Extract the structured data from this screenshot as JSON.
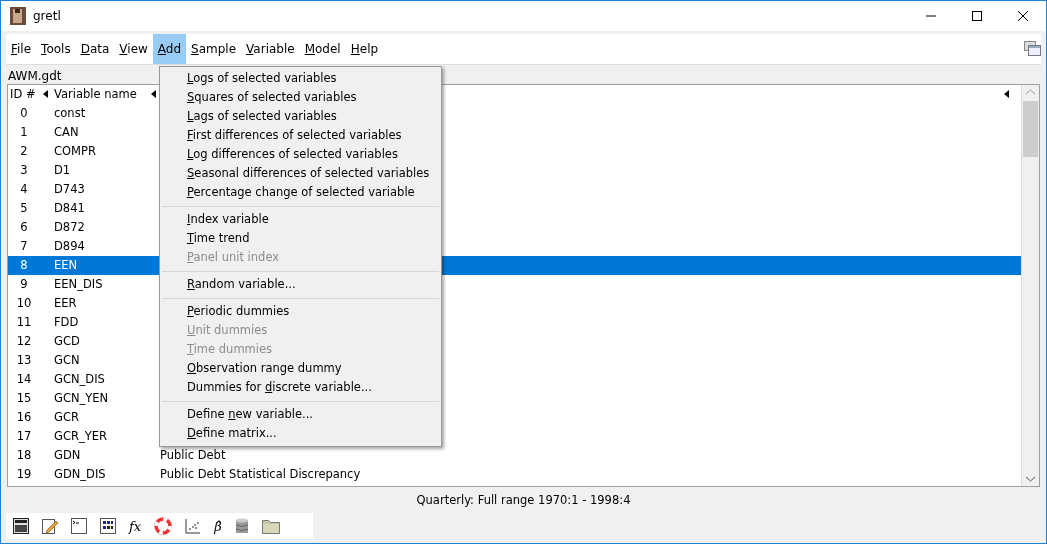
{
  "window": {
    "title": "gretl"
  },
  "menubar": [
    {
      "key": "F",
      "post": "ile",
      "selected": false
    },
    {
      "key": "T",
      "post": "ools",
      "selected": false
    },
    {
      "key": "D",
      "post": "ata",
      "selected": false
    },
    {
      "key": "V",
      "post": "iew",
      "selected": false
    },
    {
      "key": "A",
      "post": "dd",
      "selected": true
    },
    {
      "key": "S",
      "post": "ample",
      "selected": false
    },
    {
      "key": "V",
      "post": "ariable",
      "selected": false
    },
    {
      "key": "M",
      "post": "odel",
      "selected": false
    },
    {
      "key": "H",
      "post": "elp",
      "selected": false
    }
  ],
  "file_label": "AWM.gdt",
  "table": {
    "columns": [
      "ID #",
      "Variable name"
    ],
    "rows": [
      {
        "id": "0",
        "name": "const",
        "selected": false
      },
      {
        "id": "1",
        "name": "CAN",
        "selected": false
      },
      {
        "id": "2",
        "name": "COMPR",
        "selected": false
      },
      {
        "id": "3",
        "name": "D1",
        "selected": false
      },
      {
        "id": "4",
        "name": "D743",
        "selected": false
      },
      {
        "id": "5",
        "name": "D841",
        "selected": false
      },
      {
        "id": "6",
        "name": "D872",
        "selected": false
      },
      {
        "id": "7",
        "name": "D894",
        "selected": false
      },
      {
        "id": "8",
        "name": "EEN",
        "selected": true
      },
      {
        "id": "9",
        "name": "EEN_DIS",
        "selected": false
      },
      {
        "id": "10",
        "name": "EER",
        "selected": false
      },
      {
        "id": "11",
        "name": "FDD",
        "selected": false
      },
      {
        "id": "12",
        "name": "GCD",
        "selected": false
      },
      {
        "id": "13",
        "name": "GCN",
        "selected": false
      },
      {
        "id": "14",
        "name": "GCN_DIS",
        "selected": false
      },
      {
        "id": "15",
        "name": "GCN_YEN",
        "selected": false
      },
      {
        "id": "16",
        "name": "GCR",
        "selected": false
      },
      {
        "id": "17",
        "name": "GCR_YER",
        "selected": false
      },
      {
        "id": "18",
        "name": "GDN",
        "description": "Public Debt",
        "selected": false
      },
      {
        "id": "19",
        "name": "GDN_DIS",
        "description": "Public Debt Statistical Discrepancy",
        "selected": false
      }
    ]
  },
  "add_menu": [
    {
      "kind": "item",
      "key": "L",
      "post": "ogs of selected variables",
      "disabled": false
    },
    {
      "kind": "item",
      "key": "S",
      "post": "quares of selected variables",
      "disabled": false
    },
    {
      "kind": "item",
      "key": "L",
      "post": "ags of selected variables",
      "disabled": false
    },
    {
      "kind": "item",
      "key": "F",
      "post": "irst differences of selected variables",
      "disabled": false
    },
    {
      "kind": "item",
      "key": "L",
      "post": "og differences of selected variables",
      "disabled": false
    },
    {
      "kind": "item",
      "key": "S",
      "post": "easonal differences of selected variables",
      "disabled": false
    },
    {
      "kind": "item",
      "key": "P",
      "post": "ercentage change of selected variable",
      "disabled": false
    },
    {
      "kind": "separator"
    },
    {
      "kind": "item",
      "key": "I",
      "post": "ndex variable",
      "disabled": false
    },
    {
      "kind": "item",
      "key": "T",
      "post": "ime trend",
      "disabled": false
    },
    {
      "kind": "item",
      "key": "P",
      "post": "anel unit index",
      "disabled": true
    },
    {
      "kind": "separator"
    },
    {
      "kind": "item",
      "key": "R",
      "post": "andom variable...",
      "disabled": false
    },
    {
      "kind": "separator"
    },
    {
      "kind": "item",
      "key": "P",
      "post": "eriodic dummies",
      "disabled": false
    },
    {
      "kind": "item",
      "key": "U",
      "post": "nit dummies",
      "disabled": true
    },
    {
      "kind": "item",
      "key": "T",
      "post": "ime dummies",
      "disabled": true
    },
    {
      "kind": "item",
      "key": "O",
      "post": "bservation range dummy",
      "disabled": false
    },
    {
      "kind": "item",
      "pre": "Dummies for ",
      "key": "d",
      "post": "iscrete variable...",
      "disabled": false
    },
    {
      "kind": "separator"
    },
    {
      "kind": "item",
      "pre": "Define ",
      "key": "n",
      "post": "ew variable...",
      "disabled": false
    },
    {
      "kind": "item",
      "key": "D",
      "post": "efine matrix...",
      "disabled": false
    }
  ],
  "status_bar": "Quarterly: Full range 1970:1 - 1998:4",
  "toolbar": [
    {
      "kind": "calculator"
    },
    {
      "kind": "notepad"
    },
    {
      "kind": "terminal"
    },
    {
      "kind": "matrix"
    },
    {
      "kind": "text",
      "text": "fx"
    },
    {
      "kind": "lifebuoy"
    },
    {
      "kind": "scatter"
    },
    {
      "kind": "text",
      "text": "β̂"
    },
    {
      "kind": "database"
    },
    {
      "kind": "folder"
    }
  ]
}
